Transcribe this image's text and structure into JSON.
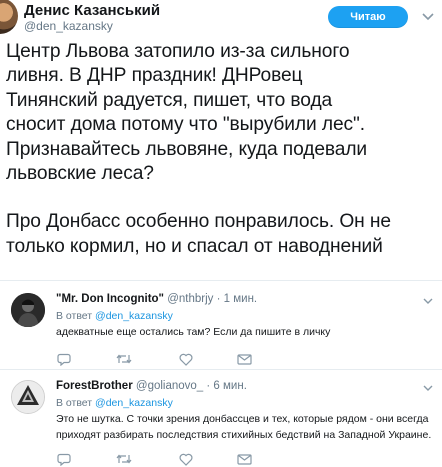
{
  "tweet": {
    "author_name": "Денис Казанський",
    "author_handle": "@den_kazansky",
    "follow_button": "Читаю",
    "lines": [
      "Центр Львова затопило из-за сильного",
      "ливня. В ДНР праздник! ДНРовец",
      "Тинянский радуется, пишет, что вода",
      "сносит дома потому что \"вырубили лес\".",
      "Признавайтесь львовяне, куда подевали",
      "львовские леса?"
    ],
    "lines2": [
      "Про Донбасс особенно понравилось. Он не",
      "только кормил, но и спасал от наводнений"
    ]
  },
  "replies": [
    {
      "name": "\"Mr. Don Incognito\"",
      "handle": "@nthbrjy",
      "time": "· 1 мин.",
      "reply_to_label": "В ответ",
      "reply_to_user": "@den_kazansky",
      "text_lines": [
        "адекватные еще остались там? Если да пишите в личку"
      ]
    },
    {
      "name": "ForestBrother",
      "handle": "@golianovo_",
      "time": "· 6 мин.",
      "reply_to_label": "В ответ",
      "reply_to_user": "@den_kazansky",
      "text_lines": [
        "Это не шутка. С точки зрения донбассцев и тех, которые рядом - они всегда",
        "приходят разбирать последствия стихийных бедствий на Западной Украине."
      ]
    }
  ],
  "icons": {
    "caret": "chevron-down-icon",
    "reply": "reply-icon",
    "retweet": "retweet-icon",
    "like": "heart-icon",
    "dm": "envelope-icon"
  },
  "colors": {
    "accent": "#1da1f2",
    "link": "#1b95e0",
    "muted": "#657786",
    "text": "#14171a",
    "divider": "#e6ecf0"
  }
}
